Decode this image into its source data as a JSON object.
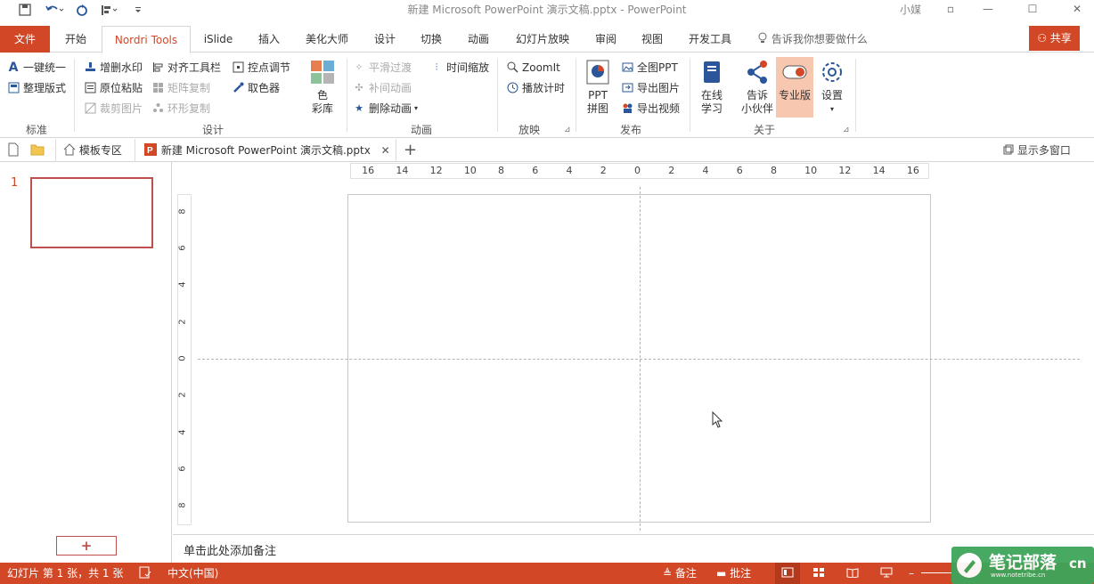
{
  "window": {
    "title": "新建 Microsoft PowerPoint 演示文稿.pptx  -  PowerPoint",
    "user": "小媒"
  },
  "tabs": {
    "file": "文件",
    "items": [
      "开始",
      "Nordri Tools",
      "iSlide",
      "插入",
      "美化大师",
      "设计",
      "切换",
      "动画",
      "幻灯片放映",
      "审阅",
      "视图",
      "开发工具"
    ],
    "tellme": "告诉我你想要做什么",
    "share": "共享"
  },
  "ribbon": {
    "standard": {
      "one_click": "一键统一",
      "organize": "整理版式",
      "group": "标准"
    },
    "design": {
      "watermark": "增删水印",
      "align_bar": "对齐工具栏",
      "anchor": "控点调节",
      "paste_in_place": "原位粘贴",
      "matrix_copy": "矩阵复制",
      "color_picker": "取色器",
      "crop_image": "裁剪图片",
      "ring_copy": "环形复制",
      "palette_line1": "色",
      "palette_line2": "彩库",
      "group": "设计"
    },
    "animation": {
      "smooth": "平滑过渡",
      "time_scale": "时间缩放",
      "tween": "补间动画",
      "delete_anim": "删除动画",
      "group": "动画"
    },
    "show": {
      "zoomit": "ZoomIt",
      "timer": "播放计时",
      "group": "放映"
    },
    "publish": {
      "ppt_puzzle_1": "PPT",
      "ppt_puzzle_2": "拼图",
      "full_ppt": "全图PPT",
      "export_image": "导出图片",
      "export_video": "导出视频",
      "group": "发布"
    },
    "about": {
      "online_1": "在线",
      "online_2": "学习",
      "tell_1": "告诉",
      "tell_2": "小伙伴",
      "pro": "专业版",
      "settings": "设置",
      "group": "关于"
    }
  },
  "doctabs": {
    "template": "模板专区",
    "document": "新建 Microsoft PowerPoint 演示文稿.pptx",
    "multi_window": "显示多窗口"
  },
  "rulers": {
    "horizontal": [
      "16",
      "14",
      "12",
      "10",
      "8",
      "6",
      "4",
      "2",
      "0",
      "2",
      "4",
      "6",
      "8",
      "10",
      "12",
      "14",
      "16"
    ],
    "vertical": [
      "8",
      "6",
      "4",
      "2",
      "0",
      "2",
      "4",
      "6",
      "8"
    ]
  },
  "thumbs": {
    "slide_number": "1"
  },
  "notes": {
    "placeholder": "单击此处添加备注"
  },
  "status": {
    "slide_info": "幻灯片 第 1 张，共 1 张",
    "language": "中文(中国)",
    "notes": "备注",
    "comments": "批注"
  },
  "watermark": {
    "title": "笔记部落",
    "url": "www.notetribe.cn",
    "suffix": "cn"
  },
  "colors": {
    "accent": "#d24726",
    "pro_bg": "#f8c7b0",
    "watermark": "#3ea55a"
  }
}
